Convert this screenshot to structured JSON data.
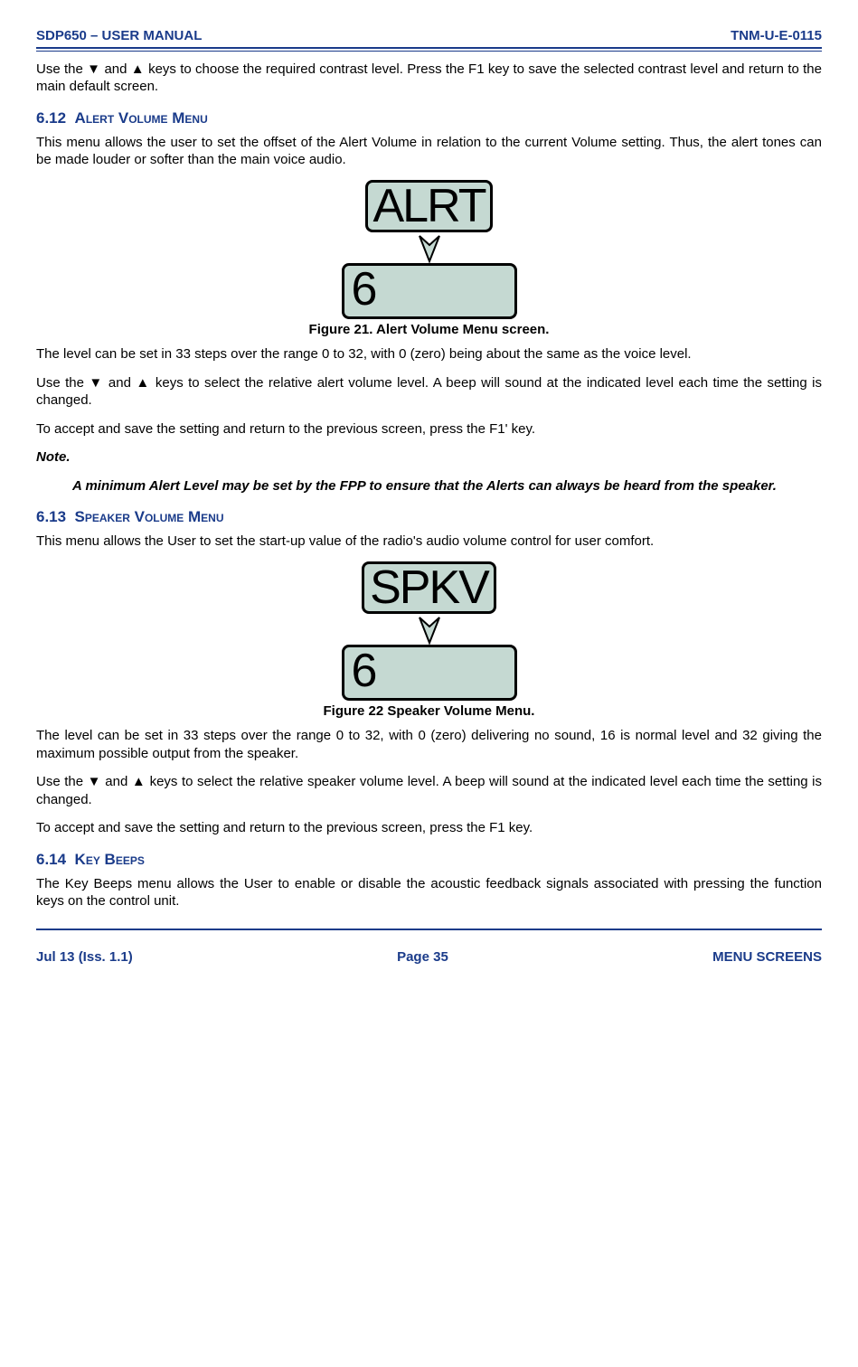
{
  "header": {
    "left": "SDP650 – USER MANUAL",
    "right": "TNM-U-E-0115"
  },
  "intro_p": "Use the ▼ and ▲ keys to choose the required contrast level.  Press the F1 key to save the selected contrast level and return to the main default screen.",
  "s612": {
    "heading_num": "6.12",
    "heading_text": "Alert Volume Menu",
    "p1": "This menu allows the user to set the offset of the Alert Volume in relation to the current Volume setting.  Thus, the alert tones can be made louder or softer than the main voice audio.",
    "lcd_top": "ALRT",
    "lcd_bottom": "6",
    "caption": "Figure 21.  Alert Volume Menu screen.",
    "p2": "The level can be set in 33 steps over the range 0 to 32, with 0 (zero) being about the same as the voice level.",
    "p3": "Use the ▼ and ▲ keys to select the relative alert volume level.  A beep will sound at the indicated level each time the setting is changed.",
    "p4": "To accept and save the setting and return to the previous screen, press the F1' key.",
    "note_label": "Note.",
    "note_body": "A minimum Alert Level may be set by the FPP to ensure that the Alerts can always be heard from the speaker."
  },
  "s613": {
    "heading_num": "6.13",
    "heading_text": "Speaker Volume Menu",
    "p1": "This menu allows the User to set the start-up value of the radio's audio volume control for user comfort.",
    "lcd_top": "SPKV",
    "lcd_bottom": "6",
    "caption": "Figure 22  Speaker Volume Menu.",
    "p2": "The level can be set in 33 steps over the range 0 to 32, with 0 (zero) delivering no sound, 16 is normal level and 32 giving the maximum possible output from the speaker.",
    "p3": "Use the ▼ and ▲ keys to select the relative speaker volume level.  A beep will sound at the indicated level each time the setting is changed.",
    "p4": "To accept and save the setting and return to the previous screen, press the F1 key."
  },
  "s614": {
    "heading_num": "6.14",
    "heading_text": "Key Beeps",
    "p1": "The Key Beeps menu allows the User to enable or disable the acoustic feedback signals associated with pressing the function keys on the control unit."
  },
  "footer": {
    "left": "Jul 13 (Iss. 1.1)",
    "center": "Page 35",
    "right": "MENU SCREENS"
  }
}
